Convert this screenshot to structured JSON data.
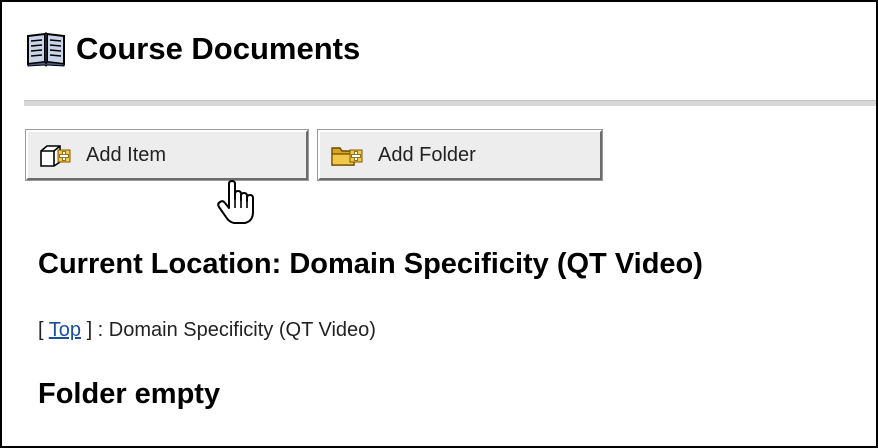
{
  "header": {
    "title": "Course Documents",
    "icon": "book-icon"
  },
  "toolbar": {
    "add_item_label": "Add Item",
    "add_item_icon": "add-item-icon",
    "add_folder_label": "Add Folder",
    "add_folder_icon": "add-folder-icon"
  },
  "location": {
    "heading": "Current Location: Domain Specificity (QT Video)",
    "breadcrumb_open": "[ ",
    "breadcrumb_top_link": "Top",
    "breadcrumb_rest": " ] : Domain Specificity (QT Video)"
  },
  "content": {
    "empty_message": "Folder empty"
  },
  "cursor": {
    "icon": "hand-pointer-icon"
  }
}
